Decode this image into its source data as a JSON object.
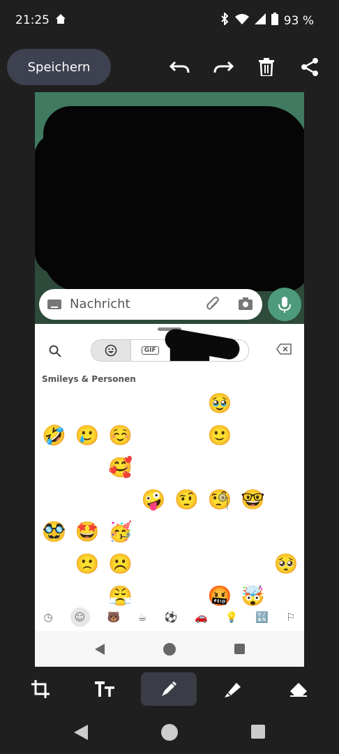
{
  "status": {
    "time": "21:25",
    "battery": "93 %"
  },
  "toolbar": {
    "save_label": "Speichern"
  },
  "screenshot": {
    "message_placeholder": "Nachricht",
    "keyboard": {
      "gif_label": "GIF",
      "section_label": "Smileys & Personen",
      "emojis": [
        "😀",
        "😃",
        "😄",
        "😁",
        "😆",
        "🥹",
        "😅",
        "😂",
        "🤣",
        "🥲",
        "☺️",
        "😊",
        "😇",
        "🙂",
        "🙃",
        "😉",
        "😌",
        "😍",
        "🥰",
        "😘",
        "😗",
        "😙",
        "😚",
        "😋",
        "😛",
        "😝",
        "😜",
        "🤪",
        "🤨",
        "🧐",
        "🤓",
        "😎",
        "🥸",
        "🤩",
        "🥳",
        "😏",
        "😒",
        "😞",
        "😔",
        "😟",
        "😕",
        "🙁",
        "☹️",
        "😣",
        "😖",
        "😫",
        "😩",
        "🥺",
        "😢",
        "😭",
        "😤",
        "😠",
        "😡",
        "🤬",
        "🤯",
        "😳"
      ],
      "categories": [
        "clock-icon",
        "smiley-icon",
        "animal-icon",
        "food-icon",
        "sport-icon",
        "car-icon",
        "bulb-icon",
        "symbols-icon",
        "flag-icon"
      ]
    }
  },
  "tools": [
    "crop-icon",
    "text-icon",
    "pen-icon",
    "highlighter-icon",
    "eraser-icon"
  ]
}
